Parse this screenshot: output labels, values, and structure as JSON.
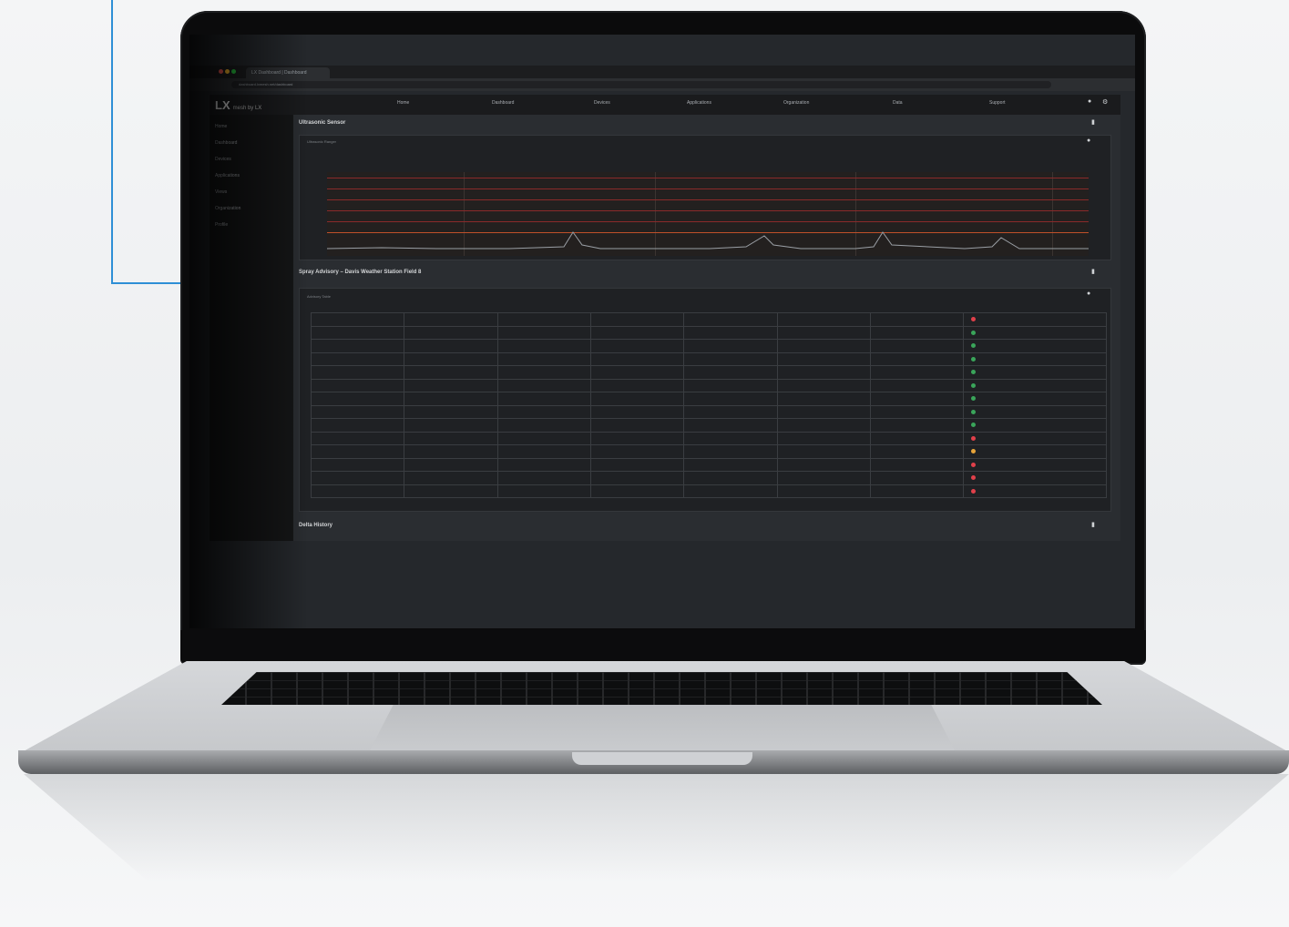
{
  "browser": {
    "tab_title": "LX Dashboard | Dashboard",
    "url": "dashboard.lxmesh.net/dashboard"
  },
  "app": {
    "logo": "LX",
    "logo_sub": "mesh by LX",
    "nav": [
      "Home",
      "Dashboard",
      "Devices",
      "Applications",
      "Organization",
      "Data",
      "Support"
    ],
    "sidebar": [
      "Home",
      "Dashboard",
      "Devices",
      "Applications",
      "Views",
      "Organization",
      "Profile"
    ],
    "section1_title": "Ultrasonic Sensor",
    "chart_panel_title": "Ultrasonic Ranger",
    "chart_y_ticks": [
      "",
      "",
      "",
      "",
      "",
      ""
    ],
    "section2_title": "Spray Advisory – Davis Weather Station Field 8",
    "table_panel_title": "Advisory Table",
    "section3_title": "Delta History"
  },
  "colors": {
    "status_red": "#e0404a",
    "status_green": "#3aa55a",
    "status_orange": "#e7a43a",
    "chart_band": "#8a2a2a",
    "callout": "#2e8fd6"
  },
  "table": {
    "rows": [
      [
        "",
        "",
        "",
        "",
        "",
        "",
        "",
        "red"
      ],
      [
        "",
        "",
        "",
        "",
        "",
        "",
        "",
        "green"
      ],
      [
        "",
        "",
        "",
        "",
        "",
        "",
        "",
        "green"
      ],
      [
        "",
        "",
        "",
        "",
        "",
        "",
        "",
        "green"
      ],
      [
        "",
        "",
        "",
        "",
        "",
        "",
        "",
        "green"
      ],
      [
        "",
        "",
        "",
        "",
        "",
        "",
        "",
        "green"
      ],
      [
        "",
        "",
        "",
        "",
        "",
        "",
        "",
        "green"
      ],
      [
        "",
        "",
        "",
        "",
        "",
        "",
        "",
        "green"
      ],
      [
        "",
        "",
        "",
        "",
        "",
        "",
        "",
        "green"
      ],
      [
        "",
        "",
        "",
        "",
        "",
        "",
        "",
        "red"
      ],
      [
        "",
        "",
        "",
        "",
        "",
        "",
        "",
        "orange"
      ],
      [
        "",
        "",
        "",
        "",
        "",
        "",
        "",
        "red"
      ],
      [
        "",
        "",
        "",
        "",
        "",
        "",
        "",
        "red"
      ],
      [
        "",
        "",
        "",
        "",
        "",
        "",
        "",
        "red"
      ]
    ]
  }
}
